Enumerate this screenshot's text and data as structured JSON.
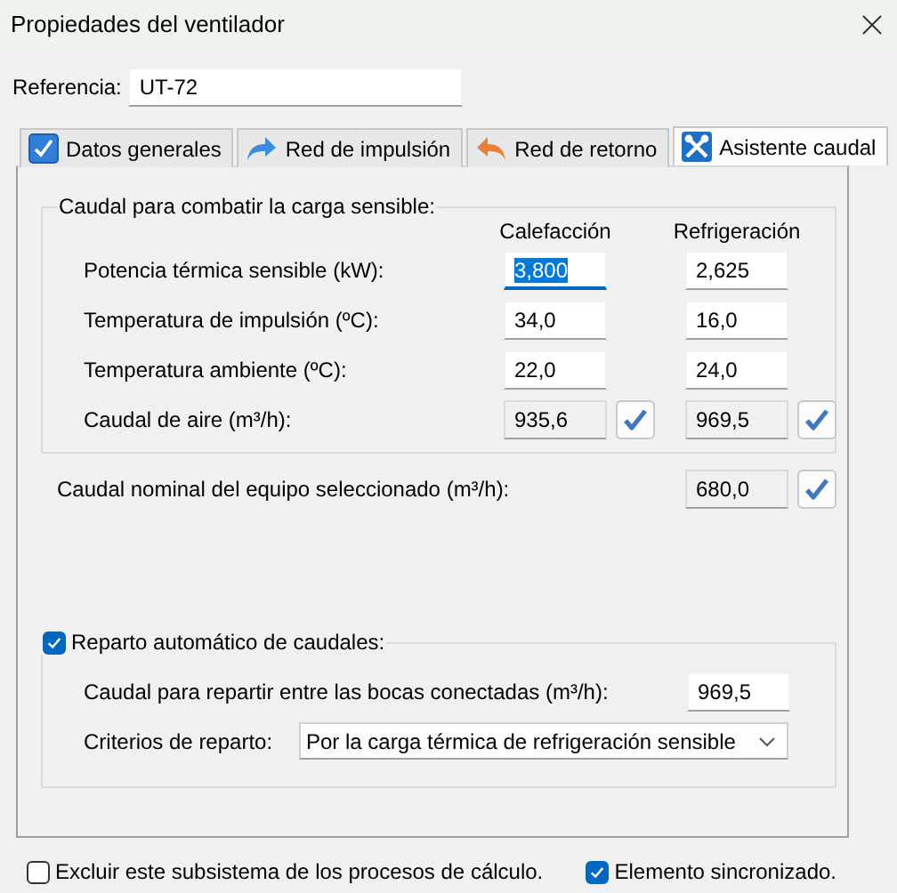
{
  "window": {
    "title": "Propiedades del ventilador"
  },
  "reference": {
    "label": "Referencia:",
    "value": "UT-72"
  },
  "tabs": [
    {
      "label": "Datos generales",
      "kind": "check",
      "selected": false
    },
    {
      "label": "Red de impulsión",
      "kind": "arrow-right",
      "selected": false
    },
    {
      "label": "Red de retorno",
      "kind": "arrow-left",
      "selected": false
    },
    {
      "label": "Asistente caudal",
      "kind": "tools",
      "selected": true
    }
  ],
  "sensible_group": {
    "title": "Caudal para combatir la carga sensible:",
    "columns": [
      "Calefacción",
      "Refrigeración"
    ],
    "rows": [
      {
        "label": "Potencia térmica sensible (kW):",
        "kind": "input",
        "values": [
          {
            "value": "3,800",
            "focused": true
          },
          {
            "value": "2,625",
            "focused": false
          }
        ]
      },
      {
        "label": "Temperatura de impulsión (ºC):",
        "kind": "input",
        "values": [
          {
            "value": "34,0",
            "focused": false
          },
          {
            "value": "16,0",
            "focused": false
          }
        ]
      },
      {
        "label": "Temperatura ambiente (ºC):",
        "kind": "input",
        "values": [
          {
            "value": "22,0",
            "focused": false
          },
          {
            "value": "24,0",
            "focused": false
          }
        ]
      },
      {
        "label": "Caudal de aire (m³/h):",
        "kind": "computed",
        "values": [
          {
            "value": "935,6",
            "focused": false
          },
          {
            "value": "969,5",
            "focused": false
          }
        ]
      }
    ]
  },
  "nominal": {
    "label": "Caudal nominal del equipo seleccionado (m³/h):",
    "value": "680,0"
  },
  "distribution": {
    "label": "Reparto automático de caudales:",
    "checked": true,
    "flow": {
      "label": "Caudal para repartir entre las bocas conectadas (m³/h):",
      "value": "969,5"
    },
    "criteria": {
      "label": "Criterios de reparto:",
      "value": "Por la carga térmica de refrigeración sensible"
    }
  },
  "footer": [
    {
      "label": "Excluir este subsistema de los procesos de cálculo.",
      "checked": false
    },
    {
      "label": "Elemento sincronizado.",
      "checked": true
    }
  ]
}
